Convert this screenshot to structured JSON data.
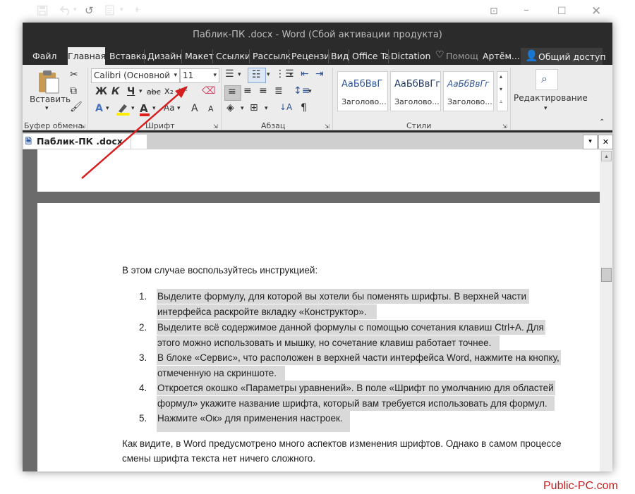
{
  "window": {
    "title": "Паблик-ПК .docx - Word (Сбой активации продукта)"
  },
  "tabs": {
    "file": "Файл",
    "home": "Главная",
    "insert": "Вставка",
    "design": "Дизайн",
    "layout": "Макет",
    "references": "Ссылки",
    "mailings": "Рассылк",
    "review": "Рецензи",
    "view": "Вид",
    "office": "Office Ta",
    "dictation": "Dictation",
    "tellme": "Помощ",
    "user": "Артём...",
    "share": "Общий доступ"
  },
  "ribbon": {
    "paste_label": "Вставить",
    "font_name": "Calibri (Основной",
    "font_size": "11",
    "bold": "Ж",
    "italic": "К",
    "underline": "Ч",
    "strike": "abc",
    "subscript": "x₂",
    "superscript": "x²",
    "font_color_letter": "A",
    "change_case": "Aa",
    "grow_font": "A",
    "shrink_font": "A",
    "styles": [
      {
        "sample": "АаБбВвГ",
        "name": "Заголово..."
      },
      {
        "sample": "АаБбВвГг",
        "name": "Заголово..."
      },
      {
        "sample": "АаБбВвГг",
        "name": "Заголово..."
      }
    ],
    "editing_label": "Редактирование",
    "groups": {
      "clipboard": "Буфер обмена",
      "font": "Шрифт",
      "paragraph": "Абзац",
      "styles": "Стили"
    }
  },
  "document": {
    "tab_name": "Паблик-ПК .docx",
    "intro": "В этом случае воспользуйтесь инструкцией:",
    "list": [
      {
        "num": "1.",
        "lines": [
          "Выделите формулу, для которой вы хотели бы поменять шрифты. В верхней части",
          "интерфейса раскройте вкладку «Конструктор»."
        ]
      },
      {
        "num": "2.",
        "lines": [
          "Выделите всё содержимое данной формулы с помощью сочетания клавиш Ctrl+A. Для",
          "этого можно использовать и мышку, но сочетание клавиш работает точнее."
        ]
      },
      {
        "num": "3.",
        "lines": [
          "В блоке «Сервис», что расположен в верхней части интерфейса Word, нажмите на кнопку,",
          "отмеченную на скриншоте."
        ]
      },
      {
        "num": "4.",
        "lines": [
          "Откроется окошко «Параметры уравнений». В поле «Шрифт по умолчанию для областей",
          "формул» укажите название шрифта, который вам требуется использовать для формул."
        ]
      },
      {
        "num": "5.",
        "lines": [
          "Нажмите «Ок» для применения настроек."
        ]
      }
    ],
    "outro": [
      "Как видите, в Word предусмотрено много аспектов изменения шрифтов. Однако в самом процессе",
      "смены шрифта текста нет ничего сложного."
    ]
  },
  "watermark": "Public-PC.com",
  "colors": {
    "accent_arrow": "#d61f1f",
    "titlebar": "#2b2b2b",
    "ribbon": "#ececec",
    "highlight": "#d9d9d9"
  }
}
